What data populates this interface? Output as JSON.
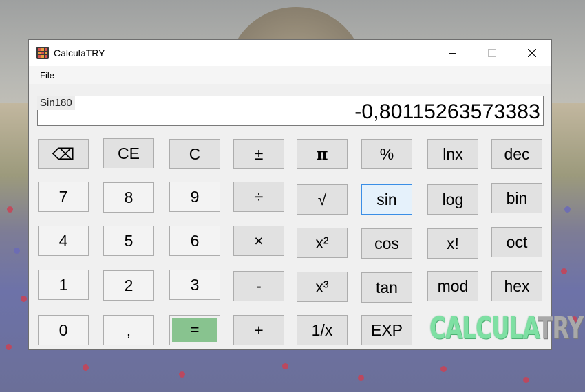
{
  "window": {
    "title": "CalculaTRY"
  },
  "menu": {
    "file": "File"
  },
  "display": {
    "expression": "Sin180",
    "result": "-0,80115263573383"
  },
  "keys": {
    "backspace": "⌫",
    "ce": "CE",
    "c": "C",
    "plusminus": "±",
    "pi": "π",
    "percent": "%",
    "lnx": "lnx",
    "dec": "dec",
    "k7": "7",
    "k8": "8",
    "k9": "9",
    "divide": "÷",
    "sqrt": "√",
    "sin": "sin",
    "log": "log",
    "bin": "bin",
    "k4": "4",
    "k5": "5",
    "k6": "6",
    "multiply": "×",
    "square": "x²",
    "cos": "cos",
    "factorial": "x!",
    "oct": "oct",
    "k1": "1",
    "k2": "2",
    "k3": "3",
    "minus": "-",
    "cube": "x³",
    "tan": "tan",
    "mod": "mod",
    "hex": "hex",
    "k0": "0",
    "comma": ",",
    "equals": "=",
    "plus": "+",
    "reciprocal": "1/x",
    "exp": "EXP"
  },
  "logo": {
    "part1": "CALCULA",
    "part2": "TRY"
  },
  "colors": {
    "equals": "#88c38f",
    "sin_highlight": "#e5f1fb",
    "logo_green": "#7ee0a3"
  }
}
